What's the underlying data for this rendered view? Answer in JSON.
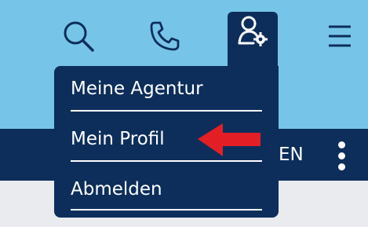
{
  "header": {
    "icons": {
      "search": "search-icon",
      "phone": "phone-icon",
      "user_settings": "user-settings-icon",
      "menu": "hamburger-menu-icon"
    },
    "colors": {
      "header_bg": "#76c5e8",
      "navy": "#0d2e5b",
      "icon_dark": "#0d2e5b",
      "annotation_arrow": "#e31e24"
    }
  },
  "user_menu": {
    "items": [
      {
        "label": "Meine Agentur"
      },
      {
        "label": "Mein Profil"
      },
      {
        "label": "Abmelden"
      }
    ]
  },
  "navbar": {
    "partial_text": "EN"
  }
}
